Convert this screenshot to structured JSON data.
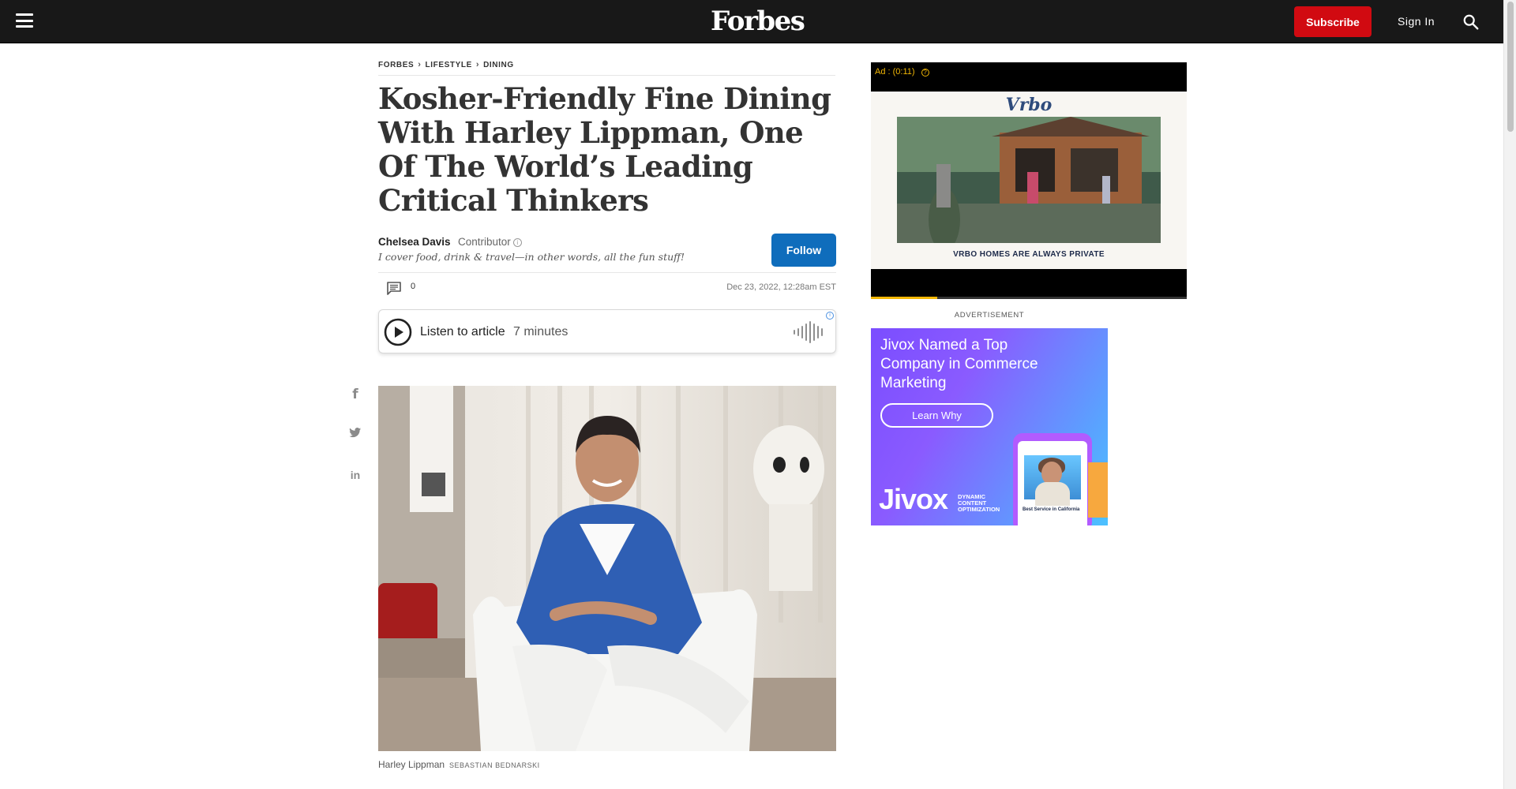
{
  "header": {
    "logo": "Forbes",
    "subscribe_label": "Subscribe",
    "signin_label": "Sign In"
  },
  "breadcrumb": [
    "FORBES",
    "LIFESTYLE",
    "DINING"
  ],
  "article": {
    "headline": "Kosher-Friendly Fine Dining With Harley Lippman, One Of The World’s Leading Critical Thinkers",
    "author": {
      "name": "Chelsea Davis",
      "role": "Contributor",
      "bio": "I cover food, drink & travel—in other words, all the fun stuff!",
      "follow_label": "Follow"
    },
    "comment_count": "0",
    "date": "Dec 23, 2022, 12:28am EST",
    "listen": {
      "label": "Listen to article",
      "duration": "7 minutes"
    },
    "share": [
      "facebook-icon",
      "twitter-icon",
      "linkedin-icon"
    ],
    "caption": {
      "text": "Harley Lippman",
      "credit": "SEBASTIAN BEDNARSKI"
    }
  },
  "sidebar": {
    "video_ad": {
      "timer": "Ad : (0:11)",
      "brand": "Vrbo",
      "tagline": "VRBO HOMES ARE ALWAYS PRIVATE",
      "progress": 0.21
    },
    "ad_label": "ADVERTISEMENT",
    "display_ad": {
      "headline": "Jivox Named a Top Company in Commerce Marketing",
      "cta": "Learn Why",
      "brand": "Jivox",
      "brand_tagline": "DYNAMIC CONTENT OPTIMIZATION",
      "phone_caption": "Best Service in California"
    }
  },
  "colors": {
    "topbar": "#181818",
    "subscribe": "#d10a11",
    "follow": "#0f6dbc",
    "ad_accent": "#f2b705"
  }
}
